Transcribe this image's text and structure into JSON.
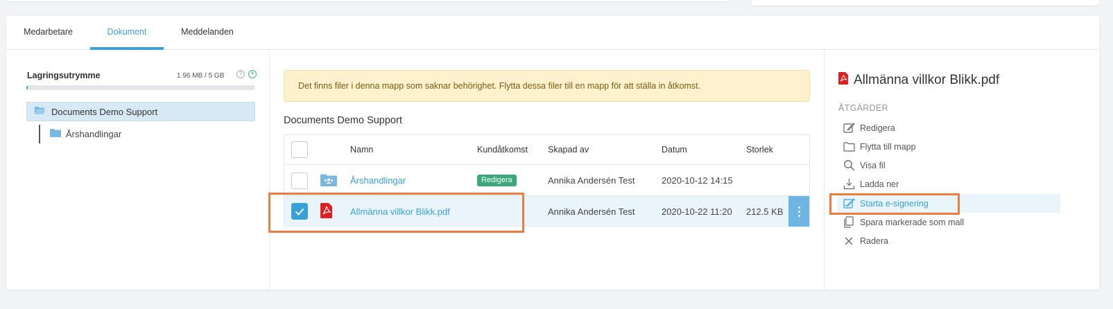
{
  "tabs": [
    {
      "label": "Medarbetare",
      "active": false
    },
    {
      "label": "Dokument",
      "active": true
    },
    {
      "label": "Meddelanden",
      "active": false
    }
  ],
  "storage": {
    "label": "Lagringsutrymme",
    "value": "1.96 MB / 5 GB",
    "used_fraction": 0.0004
  },
  "tree": {
    "root": "Documents Demo Support",
    "children": [
      "Årshandlingar"
    ]
  },
  "alert": {
    "text": "Det finns filer i denna mapp som saknar behörighet. Flytta dessa filer till en mapp för att ställa in åtkomst."
  },
  "section_title": "Documents Demo Support",
  "table": {
    "headers": {
      "name": "Namn",
      "access": "Kundåtkomst",
      "created_by": "Skapad av",
      "date": "Datum",
      "size": "Storlek"
    },
    "rows": [
      {
        "icon": "shared-folder-icon",
        "name": "Årshandlingar",
        "access": "Redigera",
        "created_by": "Annika Andersén Test",
        "date": "2020-10-12 14:15",
        "size": "",
        "selected": false
      },
      {
        "icon": "pdf-icon",
        "name": "Allmänna villkor Blikk.pdf",
        "access": "",
        "created_by": "Annika Andersén Test",
        "date": "2020-10-22 11:20",
        "size": "212.5 KB",
        "selected": true
      }
    ]
  },
  "details": {
    "file_name": "Allmänna villkor Blikk.pdf",
    "actions_heading": "ÅTGÄRDER",
    "actions": [
      {
        "icon": "edit-icon",
        "label": "Redigera"
      },
      {
        "icon": "folder-icon",
        "label": "Flytta till mapp"
      },
      {
        "icon": "search-icon",
        "label": "Visa fil"
      },
      {
        "icon": "download-icon",
        "label": "Ladda ner"
      },
      {
        "icon": "signature-icon",
        "label": "Starta e-signering",
        "active": true
      },
      {
        "icon": "copy-icon",
        "label": "Spara markerade som mall"
      },
      {
        "icon": "close-icon",
        "label": "Radera"
      }
    ]
  },
  "colors": {
    "accent": "#3aa0d8",
    "highlight": "#ef7c3e",
    "badge": "#3aa878",
    "alert_bg": "#fcf1cc",
    "pdf_red": "#e02020"
  }
}
